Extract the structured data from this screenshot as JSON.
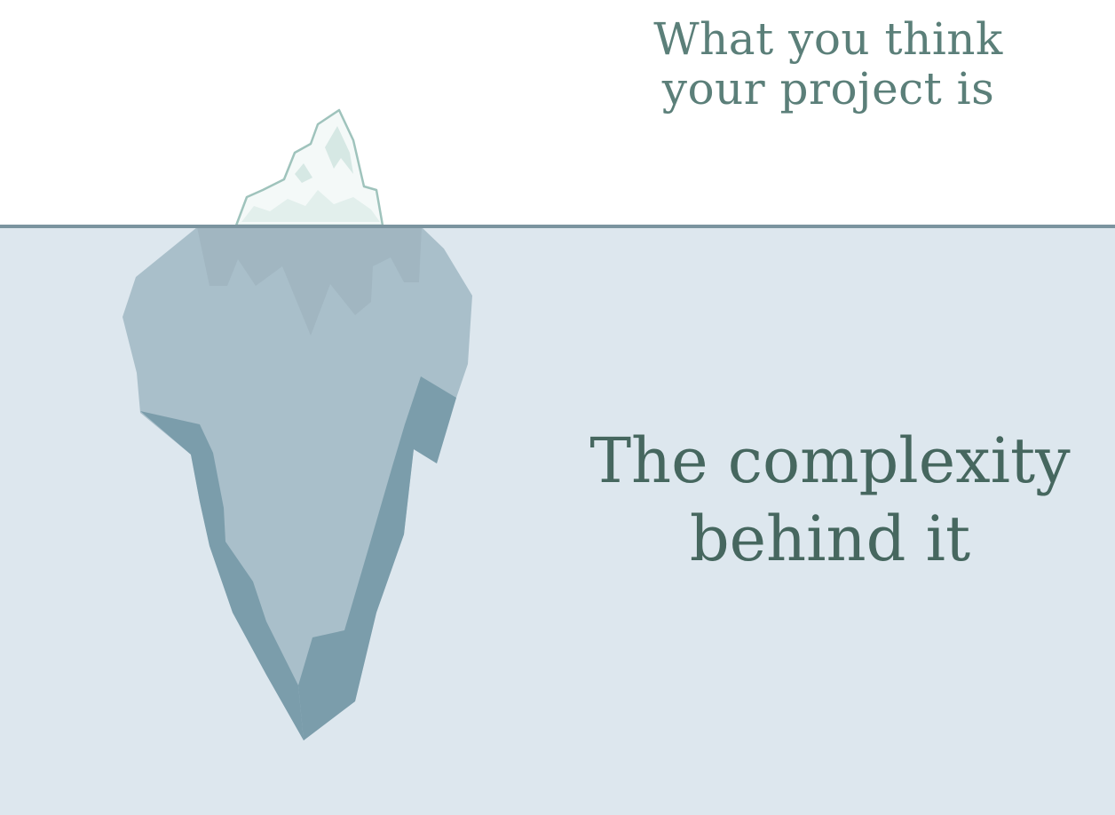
{
  "above_water": {
    "caption_line1": "What you think",
    "caption_line2": "your project is"
  },
  "below_water": {
    "caption_line1": "The complexity",
    "caption_line2": "behind it"
  },
  "colors": {
    "sky": "#ffffff",
    "water": "#dde7ee",
    "waterline": "#7b949f",
    "iceberg_tip": "#f4f9f8",
    "iceberg_tip_shadow": "#d6e8e4",
    "iceberg_tip_outline": "#9fc3bc",
    "iceberg_body": "#a9bfca",
    "iceberg_body_upper": "#a1b6c1",
    "iceberg_shadow": "#7b9dab",
    "caption_top": "#5b7f79",
    "caption_bottom": "#46675f"
  },
  "icons": [
    "iceberg-icon"
  ]
}
